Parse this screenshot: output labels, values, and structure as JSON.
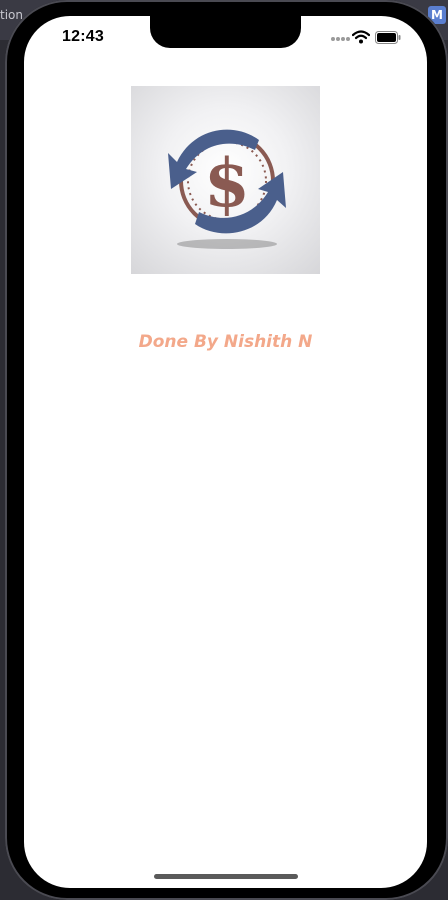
{
  "status_bar": {
    "time": "12:43",
    "signal_icon": "cellular-dots-icon",
    "wifi_icon": "wifi-icon",
    "battery_icon": "battery-icon"
  },
  "background": {
    "left_tab_fragment": "tion",
    "right_badge": "M"
  },
  "logo": {
    "icon": "currency-exchange-icon",
    "symbol": "$",
    "colors": {
      "arrows": "#4a5f8c",
      "coin": "#8a5a52"
    }
  },
  "credit_text": "Done By Nishith N",
  "colors": {
    "credit": "#f3a88a",
    "screen_bg": "#ffffff"
  }
}
